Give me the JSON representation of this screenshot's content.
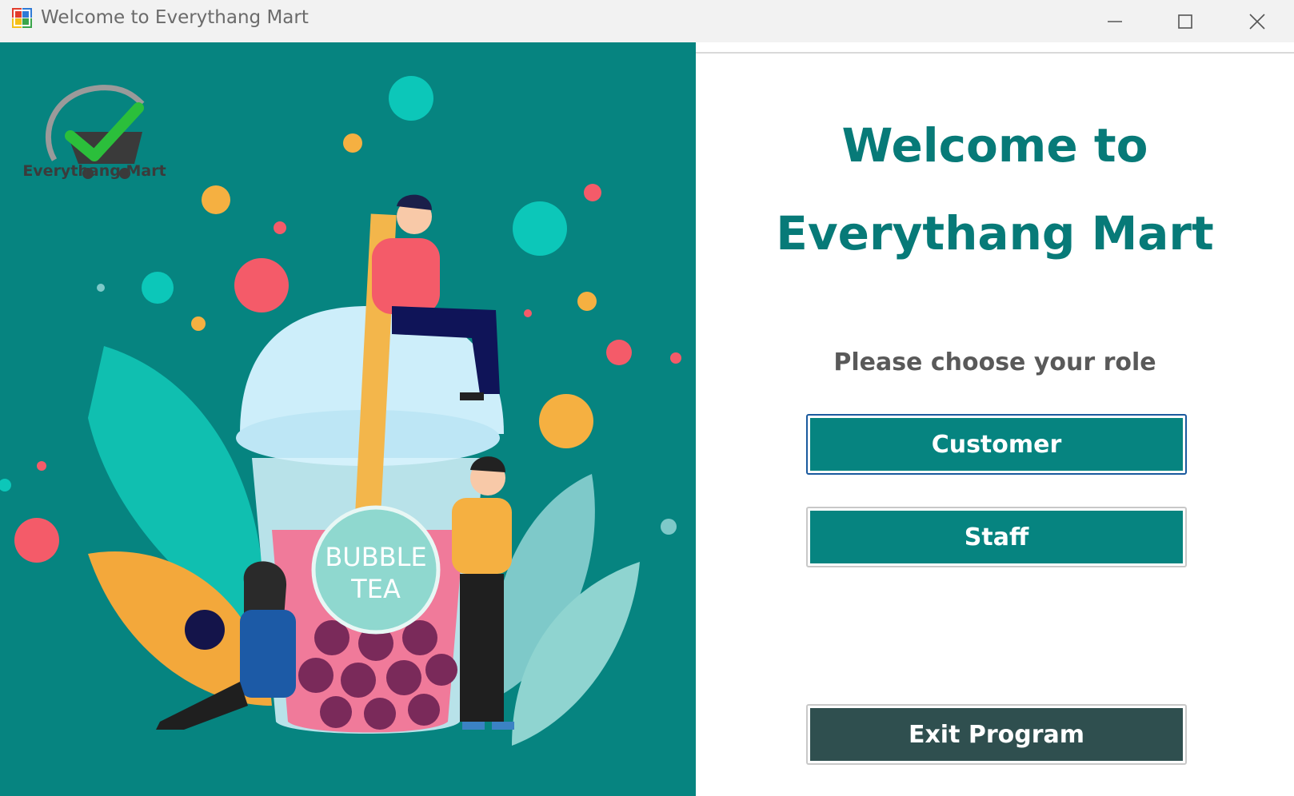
{
  "window": {
    "title": "Welcome to Everythang Mart",
    "controls": [
      "minimize",
      "maximize",
      "close"
    ]
  },
  "illustration": {
    "logo_text": "Everythang Mart",
    "cup_label_line1": "BUBBLE",
    "cup_label_line2": "TEA",
    "colors": {
      "background": "#068480",
      "accent_yellow": "#f5a623",
      "accent_pink": "#f45b69",
      "accent_teal": "#0cc7b9"
    }
  },
  "main": {
    "welcome_line1": "Welcome to",
    "welcome_line2": "Everythang Mart",
    "prompt": "Please choose your role",
    "buttons": {
      "customer": "Customer",
      "staff": "Staff",
      "exit": "Exit Program"
    },
    "colors": {
      "primary": "#068480",
      "exit": "#2f4f4f",
      "heading": "#077a78"
    }
  }
}
